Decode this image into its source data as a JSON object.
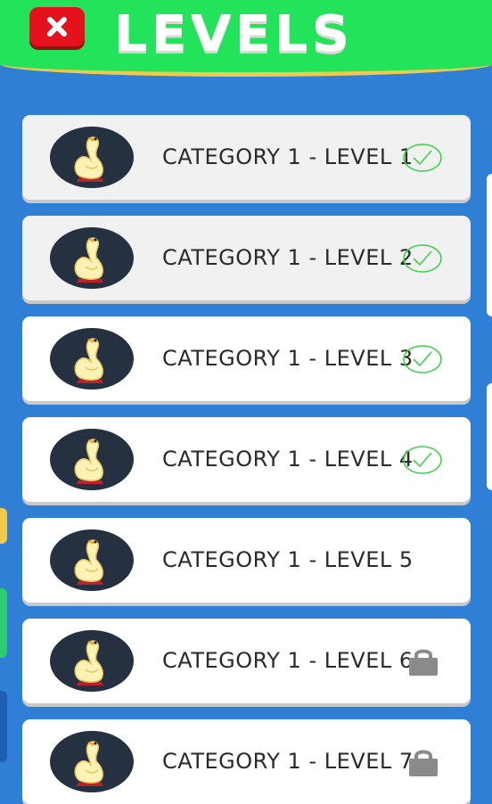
{
  "header": {
    "title": "LEVELS",
    "close_icon": "close-icon"
  },
  "levels": [
    {
      "label": "CATEGORY 1 - LEVEL 1",
      "status": "completed"
    },
    {
      "label": "CATEGORY 1 - LEVEL 2",
      "status": "completed"
    },
    {
      "label": "CATEGORY 1 - LEVEL 3",
      "status": "completed"
    },
    {
      "label": "CATEGORY 1 - LEVEL 4",
      "status": "completed"
    },
    {
      "label": "CATEGORY 1 - LEVEL 5",
      "status": "unlocked"
    },
    {
      "label": "CATEGORY 1 - LEVEL 6",
      "status": "locked"
    },
    {
      "label": "CATEGORY 1 - LEVEL 7",
      "status": "locked"
    }
  ],
  "icons": {
    "thumbnail": "duck-icon",
    "completed": "check-circle-icon",
    "locked": "lock-icon"
  },
  "colors": {
    "background": "#2f7fd6",
    "header": "#22e35a",
    "header_border": "#f2c94c",
    "close_button": "#e5121e",
    "avatar_bg": "#253040",
    "check": "#3dd24a",
    "lock": "#8a8a8a"
  }
}
